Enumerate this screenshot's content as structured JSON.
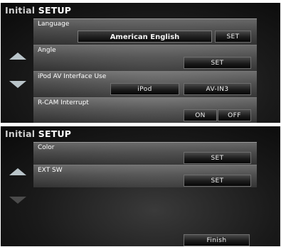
{
  "screen1": {
    "title_part1": "Initial ",
    "title_part2": "SETUP",
    "rows": [
      {
        "label": "Language",
        "value": "American English",
        "set": "SET"
      },
      {
        "label": "Angle",
        "set": "SET"
      },
      {
        "label": "iPod AV Interface Use",
        "option_a": "iPod",
        "option_b": "AV-IN3"
      },
      {
        "label": "R-CAM Interrupt",
        "option_on": "ON",
        "option_off": "OFF"
      }
    ]
  },
  "screen2": {
    "title_part1": "Initial ",
    "title_part2": "SETUP",
    "rows": [
      {
        "label": "Color",
        "set": "SET"
      },
      {
        "label": "EXT SW",
        "set": "SET"
      }
    ],
    "finish": "Finish"
  }
}
